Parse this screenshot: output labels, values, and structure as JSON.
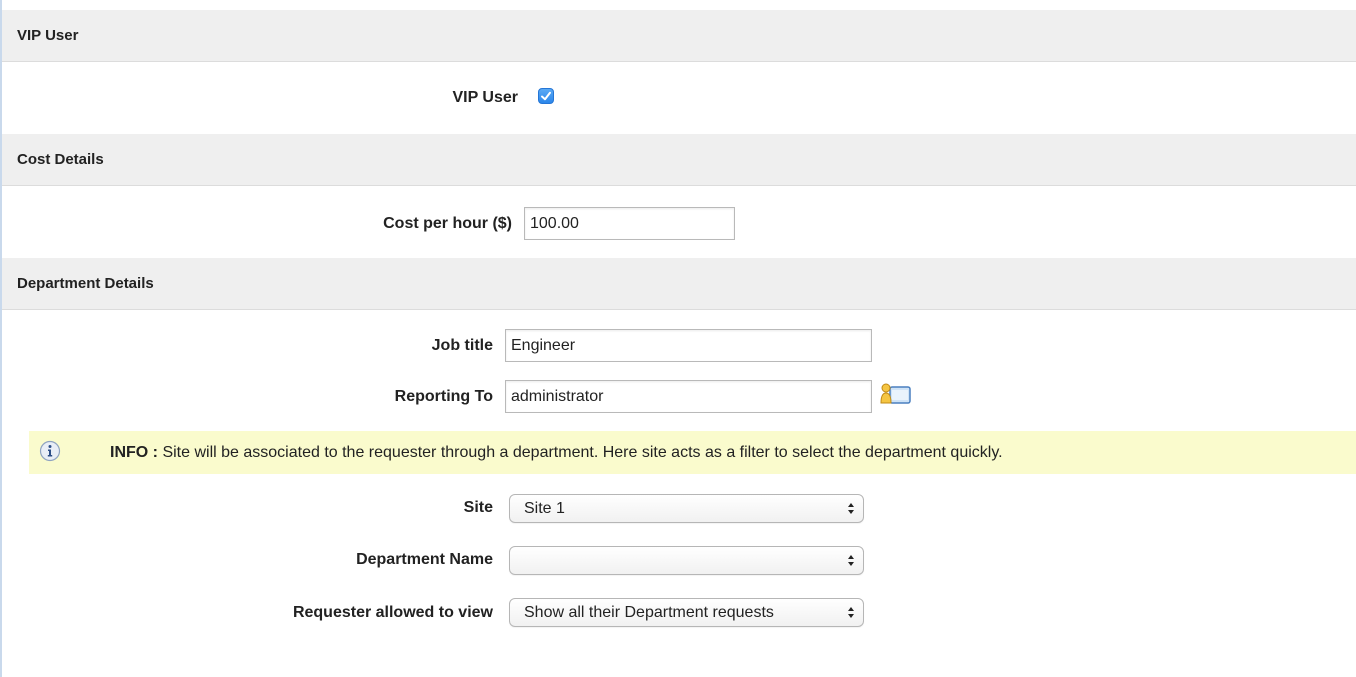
{
  "sections": {
    "vip": {
      "title": "VIP User"
    },
    "cost": {
      "title": "Cost Details"
    },
    "department": {
      "title": "Department Details"
    }
  },
  "vip_user": {
    "label": "VIP User",
    "checked": true
  },
  "cost_per_hour": {
    "label": "Cost per hour ($)",
    "value": "100.00"
  },
  "job_title": {
    "label": "Job title",
    "value": "Engineer"
  },
  "reporting_to": {
    "label": "Reporting To",
    "value": "administrator",
    "icon": "user-picker-icon"
  },
  "info": {
    "prefix": "INFO :",
    "message": "Site will be associated to the requester through a department. Here site acts as a filter to select the department quickly.",
    "icon": "info-icon"
  },
  "site": {
    "label": "Site",
    "selected": "Site 1"
  },
  "department_name": {
    "label": "Department Name",
    "selected": ""
  },
  "requester_view": {
    "label": "Requester allowed to view",
    "selected": "Show all their Department requests"
  },
  "colors": {
    "header_bg": "#efefef",
    "info_bg": "#fafbcd",
    "checkbox": "#2b86ea"
  }
}
